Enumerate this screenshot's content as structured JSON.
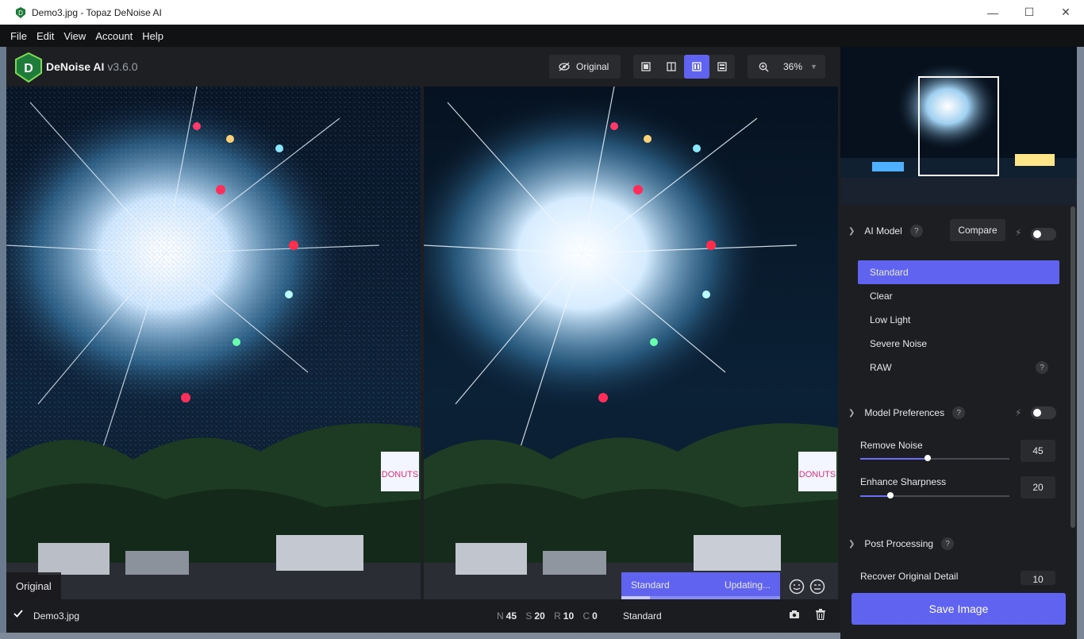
{
  "window": {
    "title": "Demo3.jpg - Topaz DeNoise AI"
  },
  "menu": [
    "File",
    "Edit",
    "View",
    "Account",
    "Help"
  ],
  "app": {
    "name": "DeNoise AI",
    "version": "v3.6.0"
  },
  "toolbar": {
    "original_label": "Original",
    "zoom": "36%",
    "view_mode_selected": "split-side-by-side"
  },
  "preview": {
    "left_label": "Original",
    "status_model": "Standard",
    "status_text": "Updating...",
    "progress": 0.18
  },
  "bottom": {
    "filename": "Demo3.jpg",
    "stats": [
      {
        "key": "N",
        "value": "45"
      },
      {
        "key": "S",
        "value": "20"
      },
      {
        "key": "R",
        "value": "10"
      },
      {
        "key": "C",
        "value": "0"
      }
    ],
    "model": "Standard"
  },
  "panel": {
    "ai_model": {
      "title": "AI Model",
      "compare_label": "Compare",
      "models": [
        "Standard",
        "Clear",
        "Low Light",
        "Severe Noise",
        "RAW"
      ],
      "selected": "Standard"
    },
    "model_prefs": {
      "title": "Model Preferences",
      "sliders": [
        {
          "label": "Remove Noise",
          "value": "45",
          "fraction": 0.45
        },
        {
          "label": "Enhance Sharpness",
          "value": "20",
          "fraction": 0.2
        }
      ]
    },
    "post": {
      "title": "Post Processing",
      "recover_label": "Recover Original Detail",
      "recover_value": "10"
    },
    "save_label": "Save Image"
  },
  "colors": {
    "accent": "#5f63f0",
    "panel": "#1d1e21",
    "background": "#1b1c1f"
  }
}
